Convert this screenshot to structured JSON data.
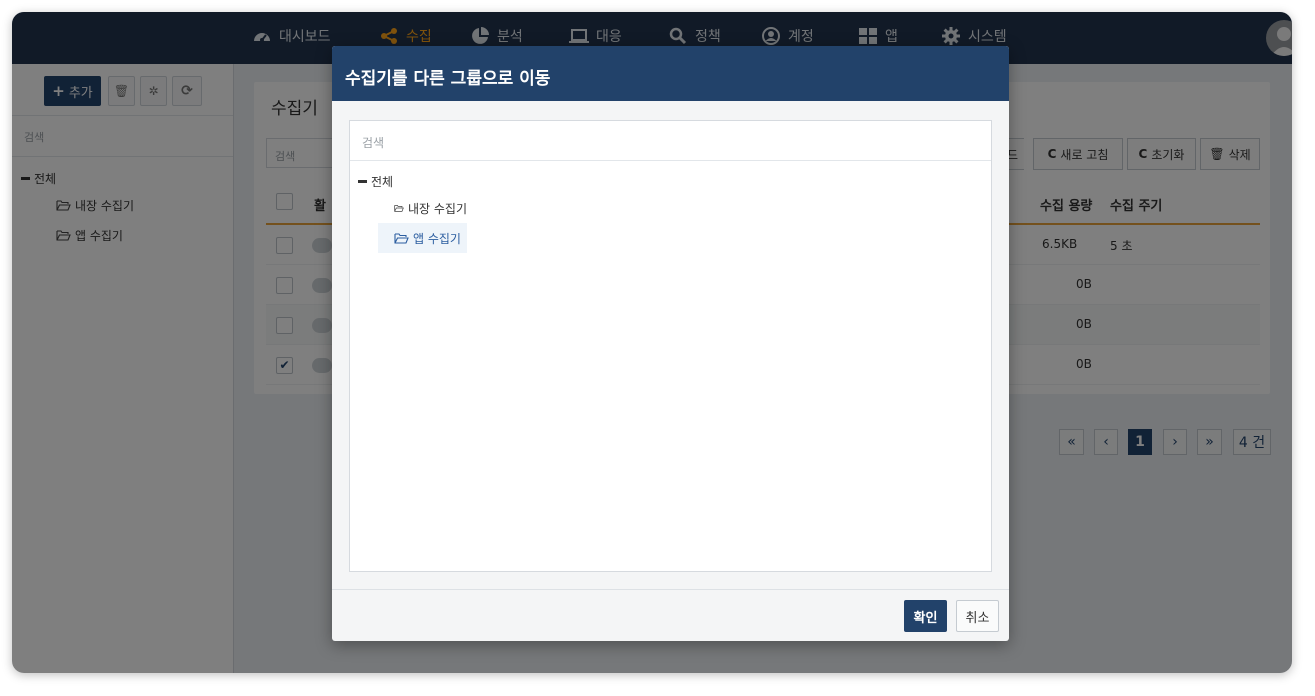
{
  "nav": {
    "items": [
      {
        "label": "대시보드",
        "icon": "dashboard-icon"
      },
      {
        "label": "수집",
        "icon": "share-icon",
        "active": true
      },
      {
        "label": "분석",
        "icon": "pie-chart-icon"
      },
      {
        "label": "대응",
        "icon": "laptop-icon"
      },
      {
        "label": "정책",
        "icon": "search-icon"
      },
      {
        "label": "계정",
        "icon": "user-circle-icon"
      },
      {
        "label": "앱",
        "icon": "grid-icon"
      },
      {
        "label": "시스템",
        "icon": "gear-icon"
      }
    ],
    "active_color": "#ffa51a"
  },
  "sidebar": {
    "add_label": "추가",
    "search_placeholder": "검색",
    "tree": {
      "root": "전체",
      "children": [
        "내장 수집기",
        "앱 수집기"
      ]
    }
  },
  "main": {
    "title": "수집기",
    "search_placeholder": "검색",
    "buttons": {
      "partial": "드",
      "refresh": "새로 고침",
      "reset": "초기화",
      "delete": "삭제"
    },
    "table": {
      "headers": {
        "active_partial": "활",
        "capacity": "수집 용량",
        "interval": "수집 주기"
      },
      "rows": [
        {
          "checked": false,
          "capacity": "6.5KB",
          "interval": "5 초"
        },
        {
          "checked": false,
          "capacity": "0B",
          "interval": ""
        },
        {
          "checked": false,
          "capacity": "0B",
          "interval": ""
        },
        {
          "checked": true,
          "capacity": "0B",
          "interval": ""
        }
      ]
    },
    "pagination": {
      "first": "«",
      "prev": "‹",
      "current": "1",
      "next": "›",
      "last": "»",
      "total": "4 건"
    }
  },
  "modal": {
    "title": "수집기를 다른 그룹으로 이동",
    "search_placeholder": "검색",
    "tree": {
      "root": "전체",
      "children": [
        "내장 수집기",
        "앱 수집기"
      ],
      "selected": "앱 수집기"
    },
    "ok_label": "확인",
    "cancel_label": "취소"
  }
}
